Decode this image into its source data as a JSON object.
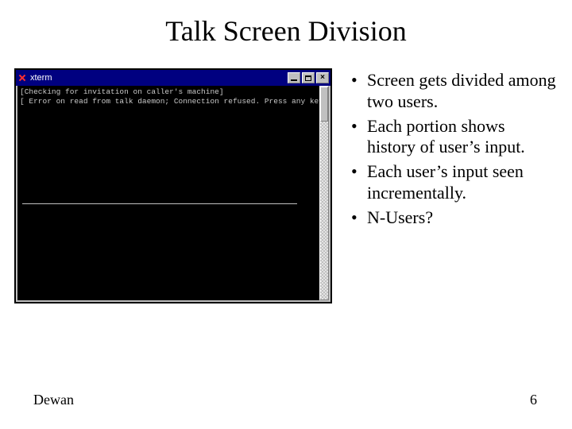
{
  "title": "Talk Screen Division",
  "terminal": {
    "window_title": "xterm",
    "line1": "[Checking for invitation on caller's machine]",
    "line2": "[ Error on read from talk daemon; Connection refused. Press any key... ]"
  },
  "bullets": [
    "Screen gets divided among two users.",
    "Each portion shows history of user’s input.",
    "Each user’s input seen incrementally.",
    "N-Users?"
  ],
  "footer": {
    "author": "Dewan",
    "page": "6"
  }
}
